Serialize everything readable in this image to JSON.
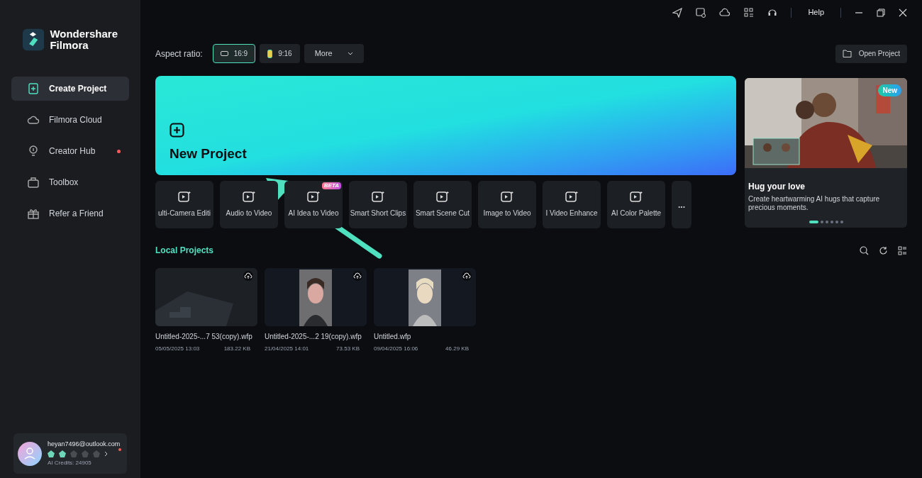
{
  "app": {
    "name_line1": "Wondershare",
    "name_line2": "Filmora"
  },
  "sidebar": {
    "items": [
      {
        "label": "Create Project",
        "selected": true,
        "notification": false
      },
      {
        "label": "Filmora Cloud",
        "selected": false,
        "notification": false
      },
      {
        "label": "Creator Hub",
        "selected": false,
        "notification": true
      },
      {
        "label": "Toolbox",
        "selected": false,
        "notification": false
      },
      {
        "label": "Refer a Friend",
        "selected": false,
        "notification": false
      }
    ]
  },
  "account": {
    "email": "heyan7496@outlook.com",
    "credits": "AI Credits: 24905",
    "notification": true,
    "badges": [
      {
        "earned": true
      },
      {
        "earned": true
      },
      {
        "earned": false
      },
      {
        "earned": false
      },
      {
        "earned": false
      }
    ]
  },
  "title_bar": {
    "help": "Help"
  },
  "aspect_ratio": {
    "label": "Aspect ratio:",
    "options": [
      {
        "label": "16:9",
        "selected": true
      },
      {
        "label": "9:16",
        "selected": false
      }
    ],
    "more": "More"
  },
  "open_project": "Open Project",
  "new_project": {
    "label": "New Project"
  },
  "tools": [
    {
      "label": "ulti-Camera Editi"
    },
    {
      "label": "Audio to Video"
    },
    {
      "label": "AI Idea to Video",
      "badge": "BETA"
    },
    {
      "label": "Smart Short Clips"
    },
    {
      "label": "Smart Scene Cut"
    },
    {
      "label": "Image to Video"
    },
    {
      "label": "I Video Enhance"
    },
    {
      "label": "AI Color Palette"
    }
  ],
  "more_tools": "...",
  "promo": {
    "badge": "New",
    "title": "Hug your love",
    "description": "Create heartwarming AI hugs that capture precious moments.",
    "slides": [
      {
        "selected": true
      },
      {
        "selected": false
      },
      {
        "selected": false
      },
      {
        "selected": false
      },
      {
        "selected": false
      },
      {
        "selected": false
      }
    ]
  },
  "local_projects": {
    "title": "Local Projects",
    "projects": [
      {
        "name": "Untitled-2025-...7 53(copy).wfp",
        "date": "05/05/2025 13:03",
        "size": "183.22 KB"
      },
      {
        "name": "Untitled-2025-...2 19(copy).wfp",
        "date": "21/04/2025 14:01",
        "size": "73.53 KB"
      },
      {
        "name": "Untitled.wfp",
        "date": "09/04/2025 16:06",
        "size": "46.29 KB"
      }
    ]
  }
}
